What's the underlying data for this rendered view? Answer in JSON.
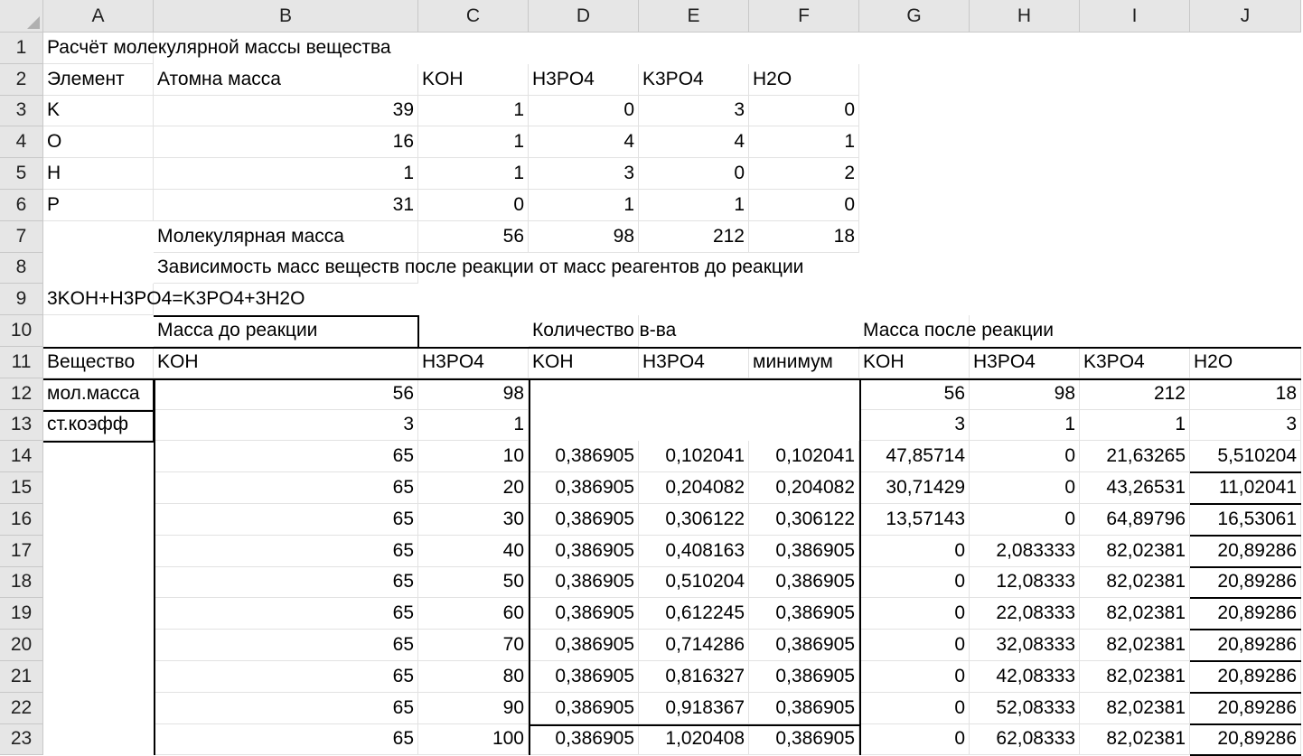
{
  "sheet": {
    "columns": [
      "A",
      "B",
      "C",
      "D",
      "E",
      "F",
      "G",
      "H",
      "I",
      "J"
    ],
    "rows": [
      1,
      2,
      3,
      4,
      5,
      6,
      7,
      8,
      9,
      10,
      11,
      12,
      13,
      14,
      15,
      16,
      17,
      18,
      19,
      20,
      21,
      22,
      23
    ],
    "cells": [
      {
        "r": 1,
        "c": "A",
        "v": "Расчёт молекулярной массы вещества",
        "t": "s"
      },
      {
        "r": 2,
        "c": "A",
        "v": "Элемент",
        "t": "s"
      },
      {
        "r": 2,
        "c": "B",
        "v": "Атомна масса",
        "t": "s"
      },
      {
        "r": 2,
        "c": "C",
        "v": "KOH",
        "t": "s"
      },
      {
        "r": 2,
        "c": "D",
        "v": "H3PO4",
        "t": "s"
      },
      {
        "r": 2,
        "c": "E",
        "v": "K3PO4",
        "t": "s"
      },
      {
        "r": 2,
        "c": "F",
        "v": "H2O",
        "t": "s"
      },
      {
        "r": 3,
        "c": "A",
        "v": "K",
        "t": "s"
      },
      {
        "r": 3,
        "c": "B",
        "v": "39",
        "t": "n"
      },
      {
        "r": 3,
        "c": "C",
        "v": "1",
        "t": "n"
      },
      {
        "r": 3,
        "c": "D",
        "v": "0",
        "t": "n"
      },
      {
        "r": 3,
        "c": "E",
        "v": "3",
        "t": "n"
      },
      {
        "r": 3,
        "c": "F",
        "v": "0",
        "t": "n"
      },
      {
        "r": 4,
        "c": "A",
        "v": "O",
        "t": "s"
      },
      {
        "r": 4,
        "c": "B",
        "v": "16",
        "t": "n"
      },
      {
        "r": 4,
        "c": "C",
        "v": "1",
        "t": "n"
      },
      {
        "r": 4,
        "c": "D",
        "v": "4",
        "t": "n"
      },
      {
        "r": 4,
        "c": "E",
        "v": "4",
        "t": "n"
      },
      {
        "r": 4,
        "c": "F",
        "v": "1",
        "t": "n"
      },
      {
        "r": 5,
        "c": "A",
        "v": "H",
        "t": "s"
      },
      {
        "r": 5,
        "c": "B",
        "v": "1",
        "t": "n"
      },
      {
        "r": 5,
        "c": "C",
        "v": "1",
        "t": "n"
      },
      {
        "r": 5,
        "c": "D",
        "v": "3",
        "t": "n"
      },
      {
        "r": 5,
        "c": "E",
        "v": "0",
        "t": "n"
      },
      {
        "r": 5,
        "c": "F",
        "v": "2",
        "t": "n"
      },
      {
        "r": 6,
        "c": "A",
        "v": "P",
        "t": "s"
      },
      {
        "r": 6,
        "c": "B",
        "v": "31",
        "t": "n"
      },
      {
        "r": 6,
        "c": "C",
        "v": "0",
        "t": "n"
      },
      {
        "r": 6,
        "c": "D",
        "v": "1",
        "t": "n"
      },
      {
        "r": 6,
        "c": "E",
        "v": "1",
        "t": "n"
      },
      {
        "r": 6,
        "c": "F",
        "v": "0",
        "t": "n"
      },
      {
        "r": 7,
        "c": "B",
        "v": "Молекулярная масса",
        "t": "s"
      },
      {
        "r": 7,
        "c": "C",
        "v": "56",
        "t": "n"
      },
      {
        "r": 7,
        "c": "D",
        "v": "98",
        "t": "n"
      },
      {
        "r": 7,
        "c": "E",
        "v": "212",
        "t": "n"
      },
      {
        "r": 7,
        "c": "F",
        "v": "18",
        "t": "n"
      },
      {
        "r": 8,
        "c": "B",
        "v": "Зависимость масс веществ после реакции от масс реагентов до реакции",
        "t": "s"
      },
      {
        "r": 9,
        "c": "A",
        "v": "3KOH+H3PO4=K3PO4+3H2O",
        "t": "s"
      },
      {
        "r": 10,
        "c": "B",
        "v": "Масса до реакции",
        "t": "s"
      },
      {
        "r": 10,
        "c": "D",
        "v": "Количество в-ва",
        "t": "s"
      },
      {
        "r": 10,
        "c": "G",
        "v": "Масса после реакции",
        "t": "s"
      },
      {
        "r": 11,
        "c": "A",
        "v": "Вещество",
        "t": "s"
      },
      {
        "r": 11,
        "c": "B",
        "v": "KOH",
        "t": "s"
      },
      {
        "r": 11,
        "c": "C",
        "v": "H3PO4",
        "t": "s"
      },
      {
        "r": 11,
        "c": "D",
        "v": "KOH",
        "t": "s"
      },
      {
        "r": 11,
        "c": "E",
        "v": "H3PO4",
        "t": "s"
      },
      {
        "r": 11,
        "c": "F",
        "v": "минимум",
        "t": "s"
      },
      {
        "r": 11,
        "c": "G",
        "v": "KOH",
        "t": "s"
      },
      {
        "r": 11,
        "c": "H",
        "v": "H3PO4",
        "t": "s"
      },
      {
        "r": 11,
        "c": "I",
        "v": "K3PO4",
        "t": "s"
      },
      {
        "r": 11,
        "c": "J",
        "v": "H2O",
        "t": "s"
      },
      {
        "r": 12,
        "c": "A",
        "v": "мол.масса",
        "t": "s"
      },
      {
        "r": 12,
        "c": "B",
        "v": "56",
        "t": "n"
      },
      {
        "r": 12,
        "c": "C",
        "v": "98",
        "t": "n"
      },
      {
        "r": 12,
        "c": "G",
        "v": "56",
        "t": "n"
      },
      {
        "r": 12,
        "c": "H",
        "v": "98",
        "t": "n"
      },
      {
        "r": 12,
        "c": "I",
        "v": "212",
        "t": "n"
      },
      {
        "r": 12,
        "c": "J",
        "v": "18",
        "t": "n"
      },
      {
        "r": 13,
        "c": "A",
        "v": "ст.коэфф",
        "t": "s"
      },
      {
        "r": 13,
        "c": "B",
        "v": "3",
        "t": "n"
      },
      {
        "r": 13,
        "c": "C",
        "v": "1",
        "t": "n"
      },
      {
        "r": 13,
        "c": "G",
        "v": "3",
        "t": "n"
      },
      {
        "r": 13,
        "c": "H",
        "v": "1",
        "t": "n"
      },
      {
        "r": 13,
        "c": "I",
        "v": "1",
        "t": "n"
      },
      {
        "r": 13,
        "c": "J",
        "v": "3",
        "t": "n"
      },
      {
        "r": 14,
        "c": "B",
        "v": "65",
        "t": "n"
      },
      {
        "r": 14,
        "c": "C",
        "v": "10",
        "t": "n"
      },
      {
        "r": 14,
        "c": "D",
        "v": "0,386905",
        "t": "n"
      },
      {
        "r": 14,
        "c": "E",
        "v": "0,102041",
        "t": "n"
      },
      {
        "r": 14,
        "c": "F",
        "v": "0,102041",
        "t": "n"
      },
      {
        "r": 14,
        "c": "G",
        "v": "47,85714",
        "t": "n"
      },
      {
        "r": 14,
        "c": "H",
        "v": "0",
        "t": "n"
      },
      {
        "r": 14,
        "c": "I",
        "v": "21,63265",
        "t": "n"
      },
      {
        "r": 14,
        "c": "J",
        "v": "5,510204",
        "t": "n"
      },
      {
        "r": 15,
        "c": "B",
        "v": "65",
        "t": "n"
      },
      {
        "r": 15,
        "c": "C",
        "v": "20",
        "t": "n"
      },
      {
        "r": 15,
        "c": "D",
        "v": "0,386905",
        "t": "n"
      },
      {
        "r": 15,
        "c": "E",
        "v": "0,204082",
        "t": "n"
      },
      {
        "r": 15,
        "c": "F",
        "v": "0,204082",
        "t": "n"
      },
      {
        "r": 15,
        "c": "G",
        "v": "30,71429",
        "t": "n"
      },
      {
        "r": 15,
        "c": "H",
        "v": "0",
        "t": "n"
      },
      {
        "r": 15,
        "c": "I",
        "v": "43,26531",
        "t": "n"
      },
      {
        "r": 15,
        "c": "J",
        "v": "11,02041",
        "t": "n"
      },
      {
        "r": 16,
        "c": "B",
        "v": "65",
        "t": "n"
      },
      {
        "r": 16,
        "c": "C",
        "v": "30",
        "t": "n"
      },
      {
        "r": 16,
        "c": "D",
        "v": "0,386905",
        "t": "n"
      },
      {
        "r": 16,
        "c": "E",
        "v": "0,306122",
        "t": "n"
      },
      {
        "r": 16,
        "c": "F",
        "v": "0,306122",
        "t": "n"
      },
      {
        "r": 16,
        "c": "G",
        "v": "13,57143",
        "t": "n"
      },
      {
        "r": 16,
        "c": "H",
        "v": "0",
        "t": "n"
      },
      {
        "r": 16,
        "c": "I",
        "v": "64,89796",
        "t": "n"
      },
      {
        "r": 16,
        "c": "J",
        "v": "16,53061",
        "t": "n"
      },
      {
        "r": 17,
        "c": "B",
        "v": "65",
        "t": "n"
      },
      {
        "r": 17,
        "c": "C",
        "v": "40",
        "t": "n"
      },
      {
        "r": 17,
        "c": "D",
        "v": "0,386905",
        "t": "n"
      },
      {
        "r": 17,
        "c": "E",
        "v": "0,408163",
        "t": "n"
      },
      {
        "r": 17,
        "c": "F",
        "v": "0,386905",
        "t": "n"
      },
      {
        "r": 17,
        "c": "G",
        "v": "0",
        "t": "n"
      },
      {
        "r": 17,
        "c": "H",
        "v": "2,083333",
        "t": "n"
      },
      {
        "r": 17,
        "c": "I",
        "v": "82,02381",
        "t": "n"
      },
      {
        "r": 17,
        "c": "J",
        "v": "20,89286",
        "t": "n"
      },
      {
        "r": 18,
        "c": "B",
        "v": "65",
        "t": "n"
      },
      {
        "r": 18,
        "c": "C",
        "v": "50",
        "t": "n"
      },
      {
        "r": 18,
        "c": "D",
        "v": "0,386905",
        "t": "n"
      },
      {
        "r": 18,
        "c": "E",
        "v": "0,510204",
        "t": "n"
      },
      {
        "r": 18,
        "c": "F",
        "v": "0,386905",
        "t": "n"
      },
      {
        "r": 18,
        "c": "G",
        "v": "0",
        "t": "n"
      },
      {
        "r": 18,
        "c": "H",
        "v": "12,08333",
        "t": "n"
      },
      {
        "r": 18,
        "c": "I",
        "v": "82,02381",
        "t": "n"
      },
      {
        "r": 18,
        "c": "J",
        "v": "20,89286",
        "t": "n"
      },
      {
        "r": 19,
        "c": "B",
        "v": "65",
        "t": "n"
      },
      {
        "r": 19,
        "c": "C",
        "v": "60",
        "t": "n"
      },
      {
        "r": 19,
        "c": "D",
        "v": "0,386905",
        "t": "n"
      },
      {
        "r": 19,
        "c": "E",
        "v": "0,612245",
        "t": "n"
      },
      {
        "r": 19,
        "c": "F",
        "v": "0,386905",
        "t": "n"
      },
      {
        "r": 19,
        "c": "G",
        "v": "0",
        "t": "n"
      },
      {
        "r": 19,
        "c": "H",
        "v": "22,08333",
        "t": "n"
      },
      {
        "r": 19,
        "c": "I",
        "v": "82,02381",
        "t": "n"
      },
      {
        "r": 19,
        "c": "J",
        "v": "20,89286",
        "t": "n"
      },
      {
        "r": 20,
        "c": "B",
        "v": "65",
        "t": "n"
      },
      {
        "r": 20,
        "c": "C",
        "v": "70",
        "t": "n"
      },
      {
        "r": 20,
        "c": "D",
        "v": "0,386905",
        "t": "n"
      },
      {
        "r": 20,
        "c": "E",
        "v": "0,714286",
        "t": "n"
      },
      {
        "r": 20,
        "c": "F",
        "v": "0,386905",
        "t": "n"
      },
      {
        "r": 20,
        "c": "G",
        "v": "0",
        "t": "n"
      },
      {
        "r": 20,
        "c": "H",
        "v": "32,08333",
        "t": "n"
      },
      {
        "r": 20,
        "c": "I",
        "v": "82,02381",
        "t": "n"
      },
      {
        "r": 20,
        "c": "J",
        "v": "20,89286",
        "t": "n"
      },
      {
        "r": 21,
        "c": "B",
        "v": "65",
        "t": "n"
      },
      {
        "r": 21,
        "c": "C",
        "v": "80",
        "t": "n"
      },
      {
        "r": 21,
        "c": "D",
        "v": "0,386905",
        "t": "n"
      },
      {
        "r": 21,
        "c": "E",
        "v": "0,816327",
        "t": "n"
      },
      {
        "r": 21,
        "c": "F",
        "v": "0,386905",
        "t": "n"
      },
      {
        "r": 21,
        "c": "G",
        "v": "0",
        "t": "n"
      },
      {
        "r": 21,
        "c": "H",
        "v": "42,08333",
        "t": "n"
      },
      {
        "r": 21,
        "c": "I",
        "v": "82,02381",
        "t": "n"
      },
      {
        "r": 21,
        "c": "J",
        "v": "20,89286",
        "t": "n"
      },
      {
        "r": 22,
        "c": "B",
        "v": "65",
        "t": "n"
      },
      {
        "r": 22,
        "c": "C",
        "v": "90",
        "t": "n"
      },
      {
        "r": 22,
        "c": "D",
        "v": "0,386905",
        "t": "n"
      },
      {
        "r": 22,
        "c": "E",
        "v": "0,918367",
        "t": "n"
      },
      {
        "r": 22,
        "c": "F",
        "v": "0,386905",
        "t": "n"
      },
      {
        "r": 22,
        "c": "G",
        "v": "0",
        "t": "n"
      },
      {
        "r": 22,
        "c": "H",
        "v": "52,08333",
        "t": "n"
      },
      {
        "r": 22,
        "c": "I",
        "v": "82,02381",
        "t": "n"
      },
      {
        "r": 22,
        "c": "J",
        "v": "20,89286",
        "t": "n"
      },
      {
        "r": 23,
        "c": "B",
        "v": "65",
        "t": "n"
      },
      {
        "r": 23,
        "c": "C",
        "v": "100",
        "t": "n"
      },
      {
        "r": 23,
        "c": "D",
        "v": "0,386905",
        "t": "n"
      },
      {
        "r": 23,
        "c": "E",
        "v": "1,020408",
        "t": "n"
      },
      {
        "r": 23,
        "c": "F",
        "v": "0,386905",
        "t": "n"
      },
      {
        "r": 23,
        "c": "G",
        "v": "0",
        "t": "n"
      },
      {
        "r": 23,
        "c": "H",
        "v": "62,08333",
        "t": "n"
      },
      {
        "r": 23,
        "c": "I",
        "v": "82,02381",
        "t": "n"
      },
      {
        "r": 23,
        "c": "J",
        "v": "20,89286",
        "t": "n"
      }
    ]
  }
}
